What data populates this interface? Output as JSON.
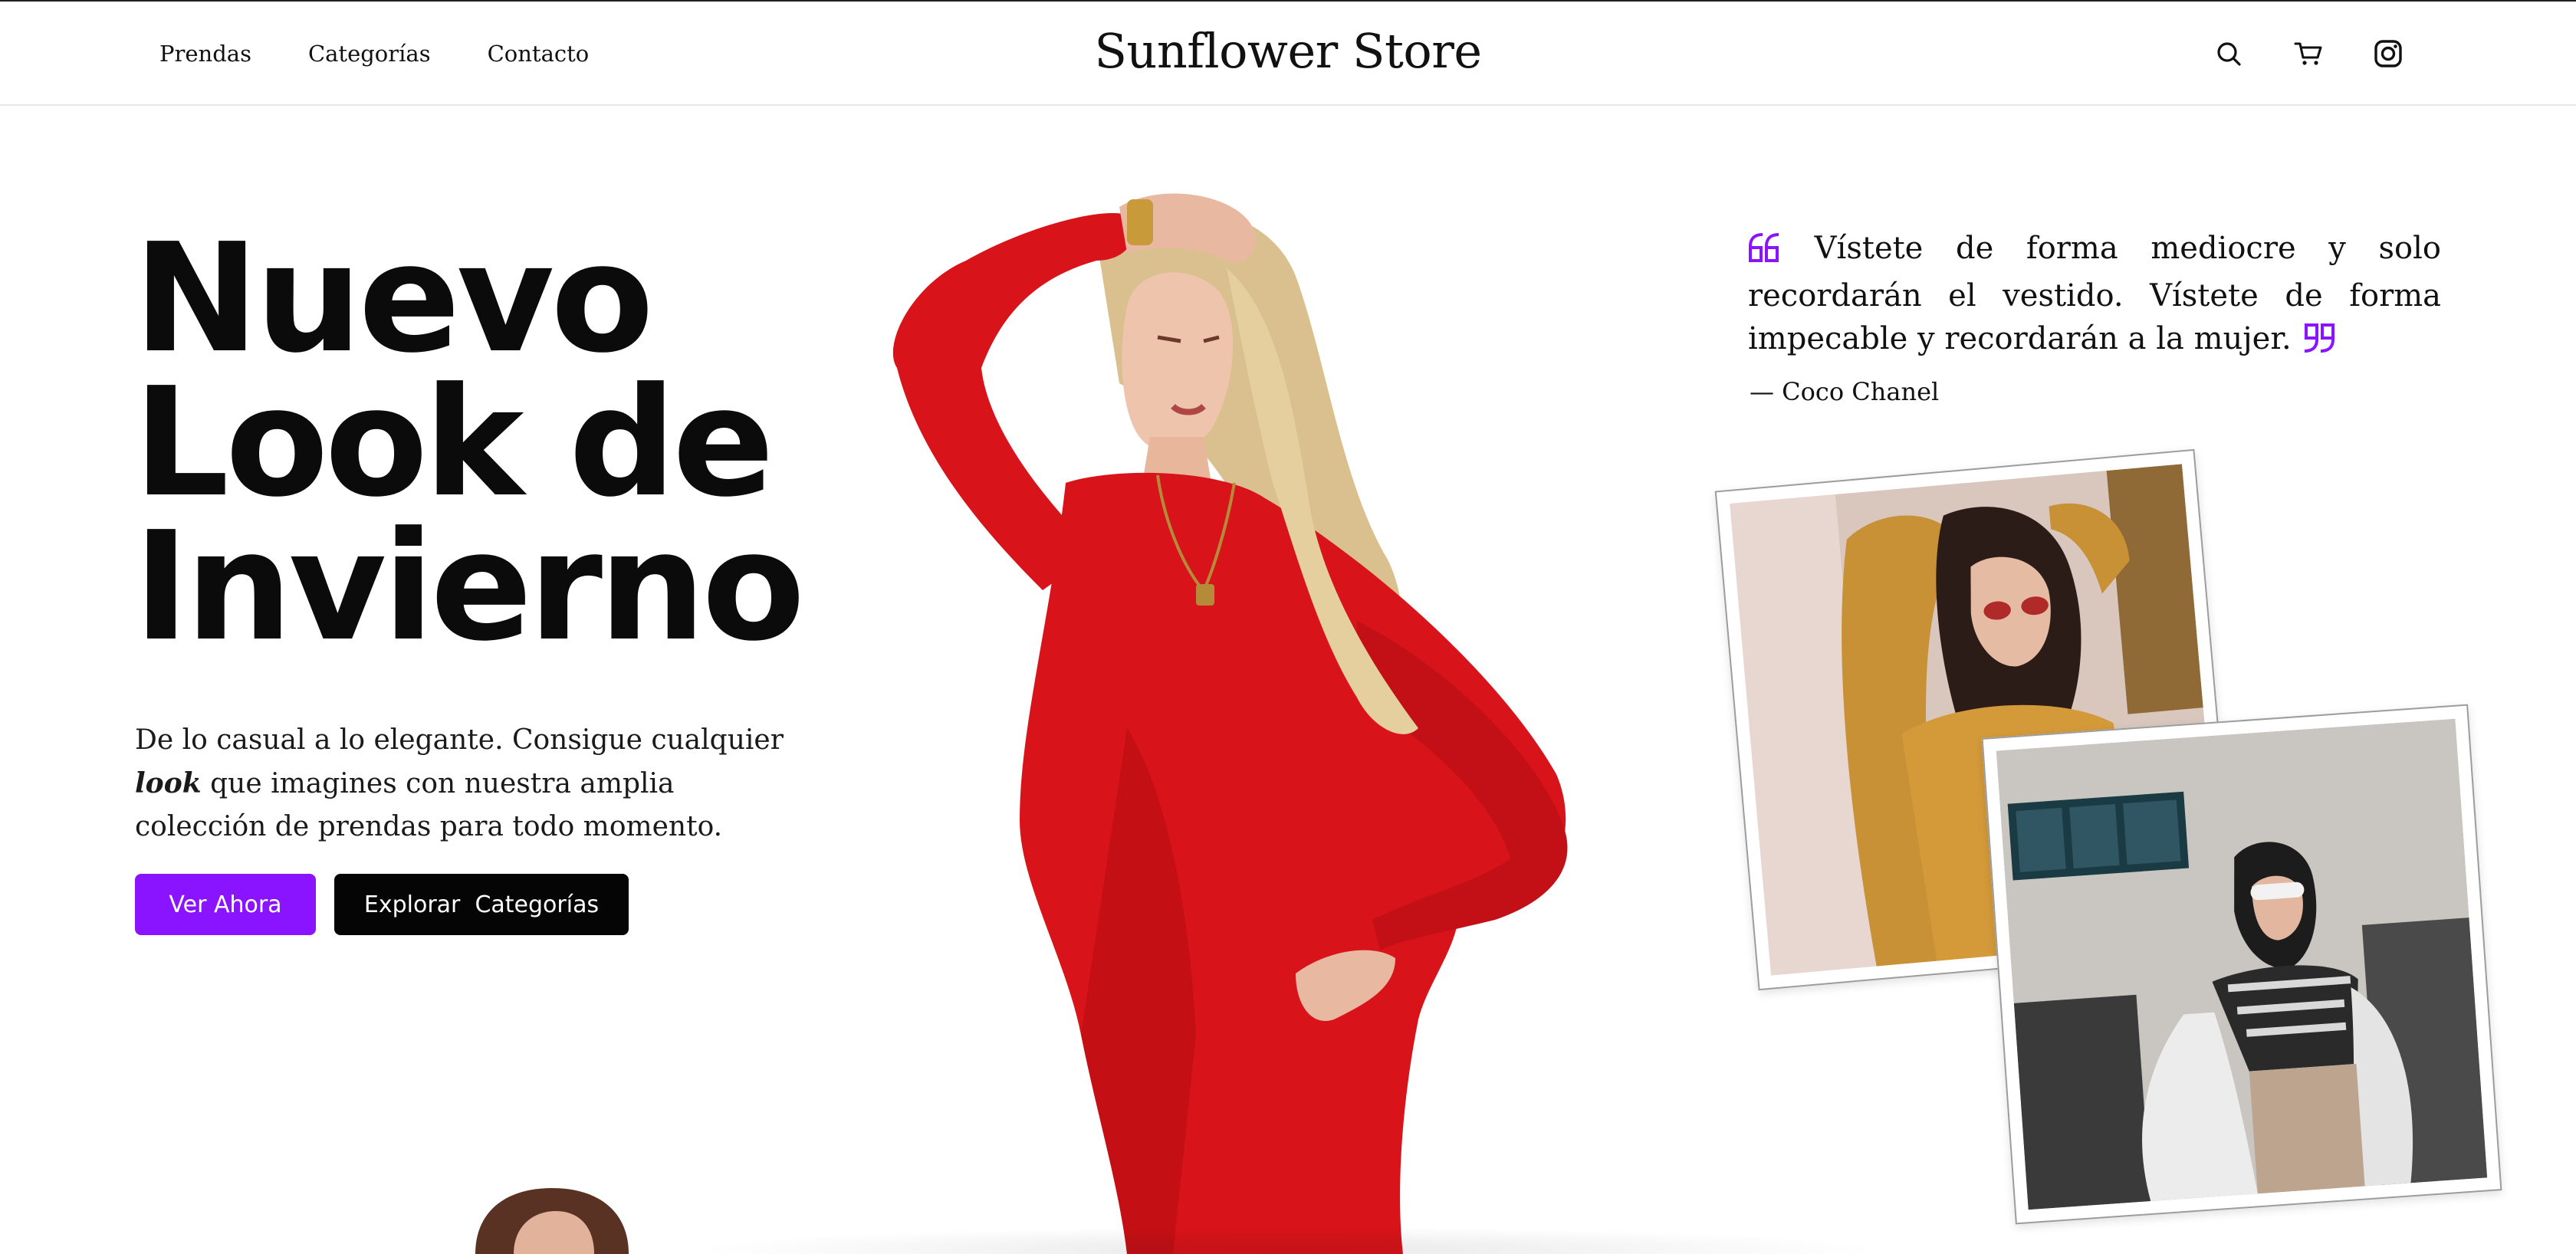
{
  "navbar": {
    "links": [
      "Prendas",
      "Categorías",
      "Contacto"
    ],
    "brand": "Sunflower Store",
    "icons": [
      "search-icon",
      "cart-icon",
      "instagram-icon"
    ]
  },
  "hero": {
    "title_lines": [
      "Nuevo",
      "Look de",
      "Invierno"
    ],
    "description_before": "De lo casual a lo elegante. Consigue cualquier ",
    "description_emphasis": "look",
    "description_after": " que imagines con nuestra amplia colección de prendas para todo momento.",
    "primary_button": "Ver Ahora",
    "secondary_button": "Explorar  Categorías"
  },
  "quote": {
    "text": "Vístete de forma mediocre y solo recordarán el vestido. Vístete de forma impecable y recordarán a la mujer.",
    "author": "— Coco Chanel"
  },
  "colors": {
    "accent": "#8a14ff",
    "dark_button": "#050505",
    "dress": "#d8141a"
  }
}
